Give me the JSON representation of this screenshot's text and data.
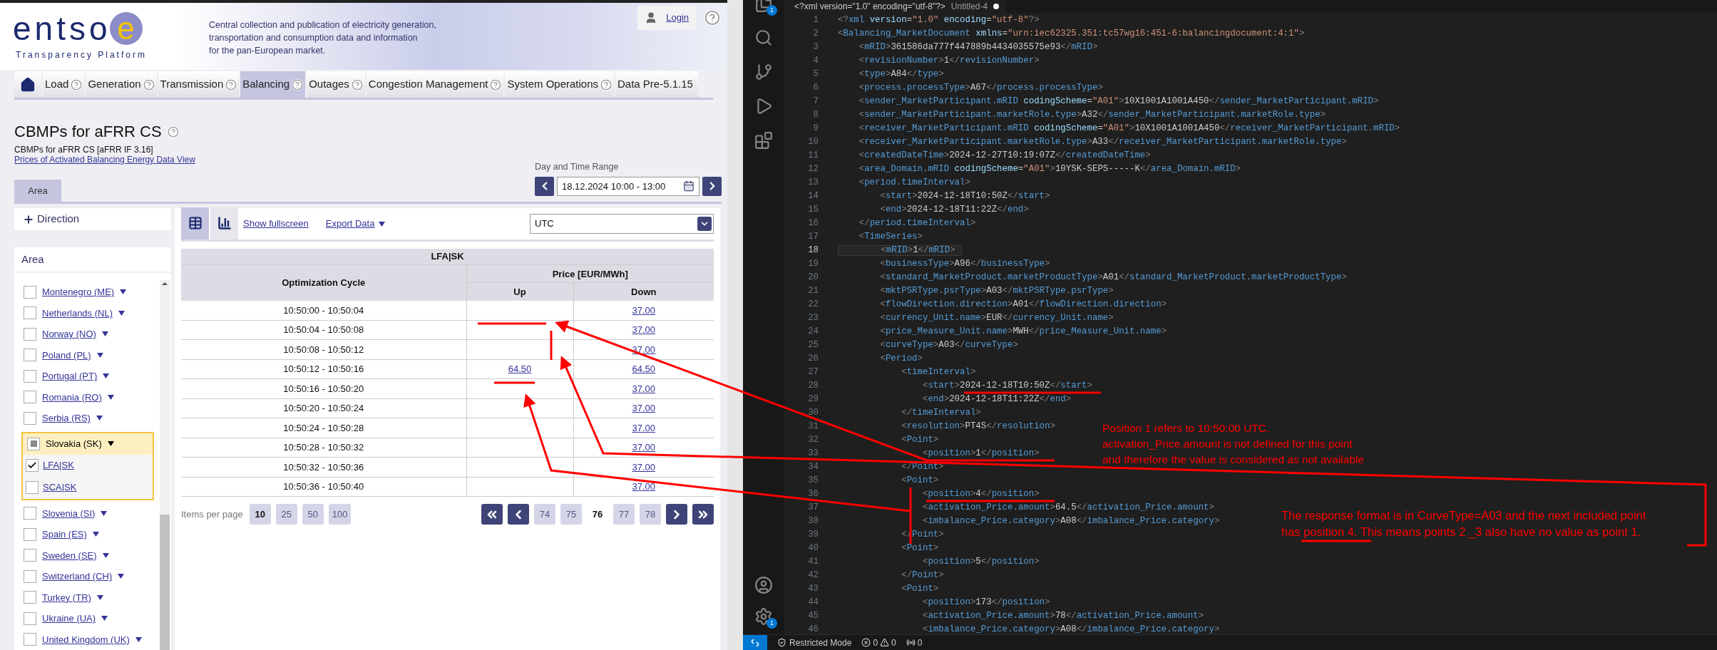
{
  "header": {
    "logo_text": "entso",
    "logo_mark": "e",
    "logo_subtitle": "Transparency Platform",
    "tagline": "Central collection and publication of electricity generation,\ntransportation and consumption data and information\nfor the pan-European market.",
    "login": "Login"
  },
  "nav": [
    {
      "label": "Load",
      "selected": false,
      "help": true
    },
    {
      "label": "Generation",
      "selected": false,
      "help": true
    },
    {
      "label": "Transmission",
      "selected": false,
      "help": true
    },
    {
      "label": "Balancing",
      "selected": true,
      "help": true
    },
    {
      "label": "Outages",
      "selected": false,
      "help": true
    },
    {
      "label": "Congestion Management",
      "selected": false,
      "help": true
    },
    {
      "label": "System Operations",
      "selected": false,
      "help": true
    },
    {
      "label": "Data Pre-5.1.15",
      "selected": false,
      "help": false
    }
  ],
  "page": {
    "title": "CBMPs for aFRR CS",
    "subtitle": "CBMPs for aFRR CS [aFRR IF 3.16]",
    "link": "Prices of Activated Balancing Energy Data View"
  },
  "view_tabs": [
    {
      "label": "Area",
      "selected": true
    }
  ],
  "date_range": {
    "label": "Day and Time Range",
    "value": "18.12.2024 10:00 - 13:00"
  },
  "sidebar": {
    "direction": "Direction",
    "area_title": "Area",
    "areas": [
      {
        "label": "Montenegro (ME)",
        "checked": false,
        "expanded": false
      },
      {
        "label": "Netherlands (NL)",
        "checked": false,
        "expanded": false
      },
      {
        "label": "Norway (NO)",
        "checked": false,
        "expanded": false
      },
      {
        "label": "Poland (PL)",
        "checked": false,
        "expanded": false
      },
      {
        "label": "Portugal (PT)",
        "checked": false,
        "expanded": false
      },
      {
        "label": "Romania (RO)",
        "checked": false,
        "expanded": false
      },
      {
        "label": "Serbia (RS)",
        "checked": false,
        "expanded": false
      },
      {
        "label": "Slovakia (SK)",
        "checked": false,
        "indeterminate": true,
        "expanded": true,
        "children": [
          {
            "label": "LFA|SK",
            "checked": true
          },
          {
            "label": "SCA|SK",
            "checked": false
          }
        ]
      },
      {
        "label": "Slovenia (SI)",
        "checked": false,
        "expanded": false
      },
      {
        "label": "Spain (ES)",
        "checked": false,
        "expanded": false
      },
      {
        "label": "Sweden (SE)",
        "checked": false,
        "expanded": false
      },
      {
        "label": "Switzerland (CH)",
        "checked": false,
        "expanded": false
      },
      {
        "label": "Turkey (TR)",
        "checked": false,
        "expanded": false
      },
      {
        "label": "Ukraine (UA)",
        "checked": false,
        "expanded": false
      },
      {
        "label": "United Kingdom (UK)",
        "checked": false,
        "expanded": false
      }
    ]
  },
  "toolbar": {
    "views": [
      {
        "kind": "table",
        "selected": true
      },
      {
        "kind": "chart",
        "selected": false
      }
    ],
    "fullscreen": "Show fullscreen",
    "export": "Export Data",
    "timezone": "UTC"
  },
  "table": {
    "title": "LFA|SK",
    "columns": {
      "cycle": "Optimization Cycle",
      "price": "Price [EUR/MWh]",
      "up": "Up",
      "down": "Down"
    },
    "rows": [
      {
        "cycle": "10:50:00 - 10:50:04",
        "down": "37.00"
      },
      {
        "cycle": "10:50:04 - 10:50:08",
        "down": "37.00"
      },
      {
        "cycle": "10:50:08 - 10:50:12",
        "down": "37.00"
      },
      {
        "cycle": "10:50:12 - 10:50:16",
        "up": "64.50",
        "down": "64.50"
      },
      {
        "cycle": "10:50:16 - 10:50:20",
        "down": "37.00"
      },
      {
        "cycle": "10:50:20 - 10:50:24",
        "down": "37.00"
      },
      {
        "cycle": "10:50:24 - 10:50:28",
        "down": "37.00"
      },
      {
        "cycle": "10:50:28 - 10:50:32",
        "down": "37.00"
      },
      {
        "cycle": "10:50:32 - 10:50:36",
        "down": "37.00"
      },
      {
        "cycle": "10:50:36 - 10:50:40",
        "down": "37.00"
      }
    ]
  },
  "pagination": {
    "items_label": "Items per page",
    "page_sizes": [
      {
        "label": "10",
        "selected": true
      },
      {
        "label": "25",
        "selected": false
      },
      {
        "label": "50",
        "selected": false
      },
      {
        "label": "100",
        "selected": false
      }
    ],
    "pages": [
      {
        "label": "74",
        "selected": false
      },
      {
        "label": "75",
        "selected": false
      },
      {
        "label": "76",
        "selected": true
      },
      {
        "label": "77",
        "selected": false
      },
      {
        "label": "78",
        "selected": false
      }
    ]
  },
  "editor": {
    "tab_title": "<?xml version=\"1.0\" encoding=\"utf-8\"?>",
    "tab_description": "Untitled-4",
    "explorer_badge": "1",
    "manage_badge": "1",
    "lines": [
      {
        "number": "1",
        "text": "<?xml version=\"1.0\" encoding=\"utf-8\"?>",
        "current": false
      },
      {
        "number": "2",
        "text": "<Balancing_MarketDocument xmlns=\"urn:iec62325.351:tc57wg16:451-6:balancingdocument:4:1\">",
        "current": false
      },
      {
        "number": "3",
        "text": "    <mRID>361586da777f447889b4434035575e93</mRID>",
        "current": false
      },
      {
        "number": "4",
        "text": "    <revisionNumber>1</revisionNumber>",
        "current": false
      },
      {
        "number": "5",
        "text": "    <type>A84</type>",
        "current": false
      },
      {
        "number": "6",
        "text": "    <process.processType>A67</process.processType>",
        "current": false
      },
      {
        "number": "7",
        "text": "    <sender_MarketParticipant.mRID codingScheme=\"A01\">10X1001A1001A450</sender_MarketParticipant.mRID>",
        "current": false
      },
      {
        "number": "8",
        "text": "    <sender_MarketParticipant.marketRole.type>A32</sender_MarketParticipant.marketRole.type>",
        "current": false
      },
      {
        "number": "9",
        "text": "    <receiver_MarketParticipant.mRID codingScheme=\"A01\">10X1001A1001A450</receiver_MarketParticipant.mRID>",
        "current": false
      },
      {
        "number": "10",
        "text": "    <receiver_MarketParticipant.marketRole.type>A33</receiver_MarketParticipant.marketRole.type>",
        "current": false
      },
      {
        "number": "11",
        "text": "    <createdDateTime>2024-12-27T10:19:07Z</createdDateTime>",
        "current": false
      },
      {
        "number": "12",
        "text": "    <area_Domain.mRID codingScheme=\"A01\">10YSK-SEPS-----K</area_Domain.mRID>",
        "current": false
      },
      {
        "number": "13",
        "text": "    <period.timeInterval>",
        "current": false
      },
      {
        "number": "14",
        "text": "        <start>2024-12-18T10:50Z</start>",
        "current": false
      },
      {
        "number": "15",
        "text": "        <end>2024-12-18T11:22Z</end>",
        "current": false
      },
      {
        "number": "16",
        "text": "    </period.timeInterval>",
        "current": false
      },
      {
        "number": "17",
        "text": "    <TimeSeries>",
        "current": false
      },
      {
        "number": "18",
        "text": "        <mRID>1</mRID>",
        "current": true
      },
      {
        "number": "19",
        "text": "        <businessType>A96</businessType>",
        "current": false
      },
      {
        "number": "20",
        "text": "        <standard_MarketProduct.marketProductType>A01</standard_MarketProduct.marketProductType>",
        "current": false
      },
      {
        "number": "21",
        "text": "        <mktPSRType.psrType>A03</mktPSRType.psrType>",
        "current": false
      },
      {
        "number": "22",
        "text": "        <flowDirection.direction>A01</flowDirection.direction>",
        "current": false
      },
      {
        "number": "23",
        "text": "        <currency_Unit.name>EUR</currency_Unit.name>",
        "current": false
      },
      {
        "number": "24",
        "text": "        <price_Measure_Unit.name>MWH</price_Measure_Unit.name>",
        "current": false
      },
      {
        "number": "25",
        "text": "        <curveType>A03</curveType>",
        "current": false
      },
      {
        "number": "26",
        "text": "        <Period>",
        "current": false
      },
      {
        "number": "27",
        "text": "            <timeInterval>",
        "current": false
      },
      {
        "number": "28",
        "text": "                <start>2024-12-18T10:50Z</start>",
        "current": false
      },
      {
        "number": "29",
        "text": "                <end>2024-12-18T11:22Z</end>",
        "current": false
      },
      {
        "number": "30",
        "text": "            </timeInterval>",
        "current": false
      },
      {
        "number": "31",
        "text": "            <resolution>PT4S</resolution>",
        "current": false
      },
      {
        "number": "32",
        "text": "            <Point>",
        "current": false
      },
      {
        "number": "33",
        "text": "                <position>1</position>",
        "current": false
      },
      {
        "number": "34",
        "text": "            </Point>",
        "current": false
      },
      {
        "number": "35",
        "text": "            <Point>",
        "current": false
      },
      {
        "number": "36",
        "text": "                <position>4</position>",
        "current": false
      },
      {
        "number": "37",
        "text": "                <activation_Price.amount>64.5</activation_Price.amount>",
        "current": false
      },
      {
        "number": "38",
        "text": "                <imbalance_Price.category>A08</imbalance_Price.category>",
        "current": false
      },
      {
        "number": "39",
        "text": "            </Point>",
        "current": false
      },
      {
        "number": "40",
        "text": "            <Point>",
        "current": false
      },
      {
        "number": "41",
        "text": "                <position>5</position>",
        "current": false
      },
      {
        "number": "42",
        "text": "            </Point>",
        "current": false
      },
      {
        "number": "43",
        "text": "            <Point>",
        "current": false
      },
      {
        "number": "44",
        "text": "                <position>173</position>",
        "current": false
      },
      {
        "number": "45",
        "text": "                <activation_Price.amount>78</activation_Price.amount>",
        "current": false
      },
      {
        "number": "46",
        "text": "                <imbalance_Price.category>A08</imbalance_Price.category>",
        "current": false
      }
    ]
  },
  "status_bar": {
    "mode": "Restricted Mode",
    "errors": "0",
    "warnings": "0",
    "ports": "0"
  },
  "annotations": [
    {
      "text": "Position 1 refers to 10:50:00 UTC.\nactivation_Price.amount is not defined for this point\nand therefore the value is considered as not available"
    },
    {
      "text": "The response format is in CurveType=A03 and the next included point\nhas position 4. This means points 2 _3 also have no value as point 1."
    }
  ]
}
